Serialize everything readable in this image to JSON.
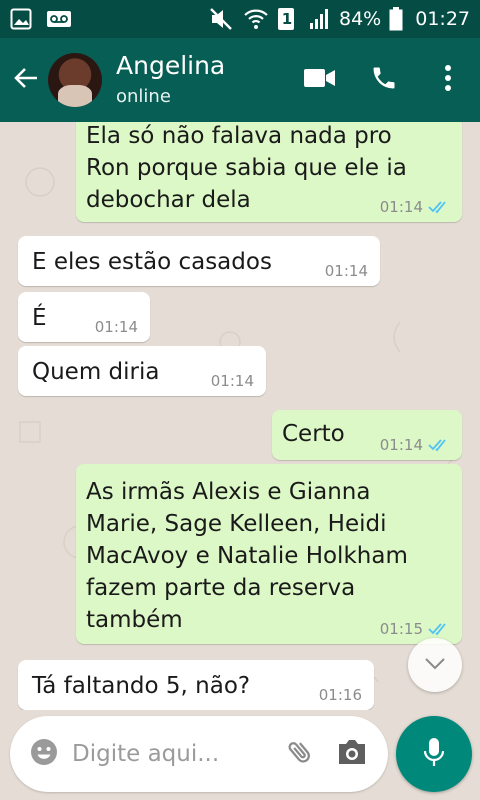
{
  "status_bar": {
    "battery_percent": "84%",
    "time": "01:27",
    "sim_label": "1",
    "icons": [
      "gallery-icon",
      "voicemail-icon",
      "mute-icon",
      "wifi-icon",
      "sim-icon",
      "signal-icon",
      "battery-icon"
    ]
  },
  "header": {
    "contact_name": "Angelina",
    "contact_status": "online",
    "icons": [
      "back-arrow-icon",
      "avatar",
      "video-call-icon",
      "phone-icon",
      "more-vert-icon"
    ]
  },
  "messages": [
    {
      "direction": "out",
      "text": "Ela só não falava nada pro\nRon porque sabia que ele ia\ndebochar dela",
      "time": "01:14",
      "read": true
    },
    {
      "direction": "in",
      "text": "E eles estão casados",
      "time": "01:14"
    },
    {
      "direction": "in",
      "text": "É",
      "time": "01:14"
    },
    {
      "direction": "in",
      "text": "Quem diria",
      "time": "01:14"
    },
    {
      "direction": "out",
      "text": "Certo",
      "time": "01:14",
      "read": true
    },
    {
      "direction": "out",
      "text": "As irmãs Alexis e Gianna\nMarie, Sage Kelleen, Heidi\nMacAvoy e Natalie Holkham\nfazem parte da reserva\ntambém",
      "time": "01:15",
      "read": true
    },
    {
      "direction": "in",
      "text": "Tá faltando 5, não?",
      "time": "01:16"
    }
  ],
  "composer": {
    "placeholder": "Digite aqui...",
    "icons": [
      "emoji-icon",
      "attach-icon",
      "camera-icon",
      "mic-icon"
    ]
  },
  "colors": {
    "status_bar": "#054d44",
    "app_bar": "#075e54",
    "chat_background": "#e5ddd5",
    "outgoing_bubble": "#dcf8c6",
    "incoming_bubble": "#ffffff",
    "read_ticks": "#4fc3f7",
    "mic_button": "#00897b"
  }
}
